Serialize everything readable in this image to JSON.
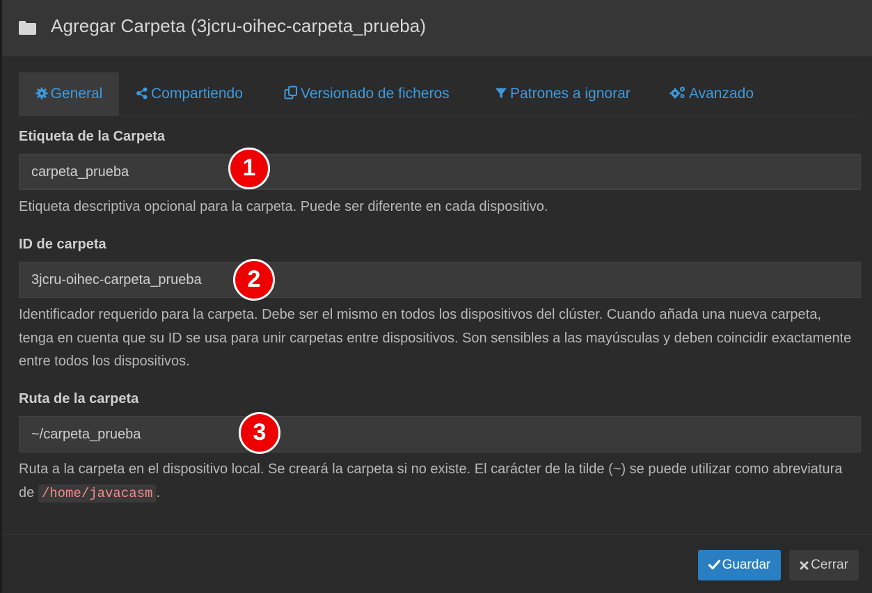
{
  "header": {
    "title": "Agregar Carpeta (3jcru-oihec-carpeta_prueba)",
    "icon": "folder-icon"
  },
  "tabs": [
    {
      "label": "General",
      "icon": "gear-icon",
      "active": true
    },
    {
      "label": "Compartiendo",
      "icon": "share-icon"
    },
    {
      "label": "Versionado de ficheros",
      "icon": "copy-icon"
    },
    {
      "label": "Patrones a ignorar",
      "icon": "filter-icon"
    },
    {
      "label": "Avanzado",
      "icon": "cogs-icon"
    }
  ],
  "fields": {
    "label": {
      "title": "Etiqueta de la Carpeta",
      "value": "carpeta_prueba",
      "help": "Etiqueta descriptiva opcional para la carpeta. Puede ser diferente en cada dispositivo.",
      "marker": "1"
    },
    "id": {
      "title": "ID de carpeta",
      "value": "3jcru-oihec-carpeta_prueba",
      "help": "Identificador requerido para la carpeta. Debe ser el mismo en todos los dispositivos del clúster. Cuando añada una nueva carpeta, tenga en cuenta que su ID se usa para unir carpetas entre dispositivos. Son sensibles a las mayúsculas y deben coincidir exactamente entre todos los dispositivos.",
      "marker": "2"
    },
    "path": {
      "title": "Ruta de la carpeta",
      "value": "~/carpeta_prueba",
      "help_before": "Ruta a la carpeta en el dispositivo local. Se creará la carpeta si no existe. El carácter de la tilde (~) se puede utilizar como abreviatura de ",
      "help_code": "/home/javacasm",
      "help_after": ".",
      "marker": "3"
    }
  },
  "footer": {
    "save_label": "Guardar",
    "close_label": "Cerrar"
  },
  "colors": {
    "accent": "#3d9be0",
    "primary_button": "#2a7fc2",
    "marker": "#ee0000"
  }
}
